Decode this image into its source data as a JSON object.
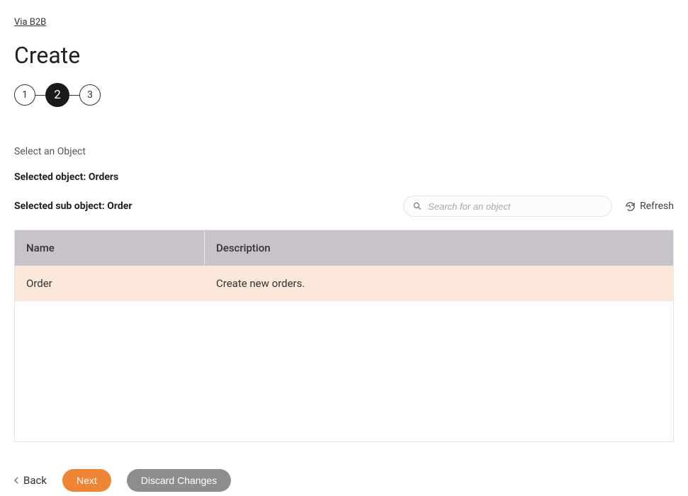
{
  "breadcrumb": "Via B2B",
  "page_title": "Create",
  "stepper": {
    "steps": [
      "1",
      "2",
      "3"
    ],
    "active_index": 1
  },
  "section_label": "Select an Object",
  "selected_object_line": "Selected object: Orders",
  "selected_sub_object_line": "Selected sub object: Order",
  "search": {
    "placeholder": "Search for an object"
  },
  "refresh_label": "Refresh",
  "table": {
    "headers": {
      "name": "Name",
      "description": "Description"
    },
    "rows": [
      {
        "name": "Order",
        "description": "Create new orders."
      }
    ]
  },
  "footer": {
    "back": "Back",
    "next": "Next",
    "discard": "Discard Changes"
  }
}
